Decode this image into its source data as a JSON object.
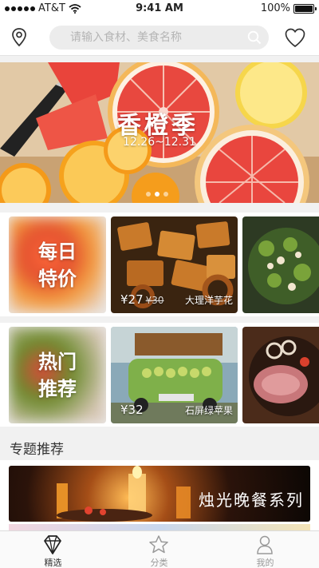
{
  "status_bar": {
    "carrier": "AT&T",
    "time": "9:41 AM",
    "battery": "100%"
  },
  "header": {
    "search_placeholder": "请输入食材、美食名称"
  },
  "banner": {
    "title": "香橙季",
    "date": "12.26~12.31",
    "slide_count": 3,
    "active_slide": 1
  },
  "daily": {
    "label_line1": "每日",
    "label_line2": "特价",
    "products": [
      {
        "price": "¥27",
        "old_price": "¥30",
        "name": "大理洋芋花"
      }
    ]
  },
  "hot": {
    "label_line1": "热门",
    "label_line2": "推荐",
    "products": [
      {
        "price": "¥32",
        "name": "石屏绿苹果"
      }
    ]
  },
  "topics": {
    "section_title": "专题推荐",
    "items": [
      {
        "title": "烛光晚餐系列"
      }
    ]
  },
  "tabbar": {
    "items": [
      {
        "label": "精选",
        "active": true
      },
      {
        "label": "分类",
        "active": false
      },
      {
        "label": "我的",
        "active": false
      }
    ]
  },
  "colors": {
    "accent_orange": "#f08a1c",
    "grapefruit": "#e8483f",
    "tab_active": "#333333",
    "tab_inactive": "#999999"
  }
}
